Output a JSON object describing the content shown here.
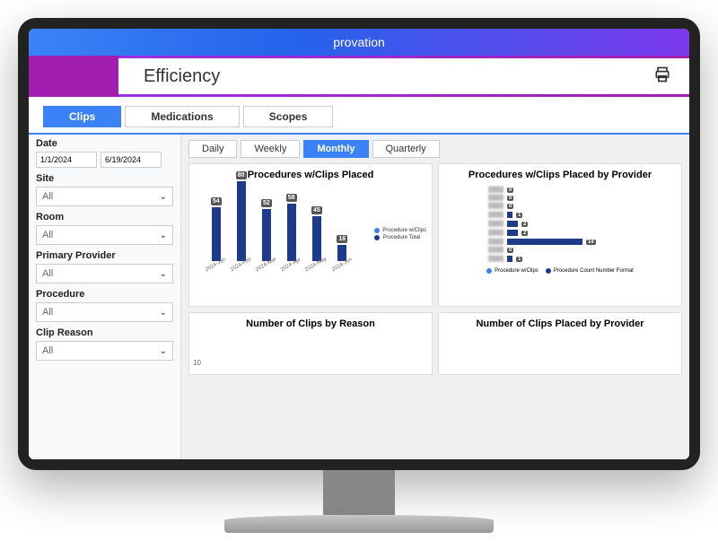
{
  "brand": "provation",
  "header": {
    "title": "Efficiency"
  },
  "main_tabs": [
    "Clips",
    "Medications",
    "Scopes"
  ],
  "active_main_tab": "Clips",
  "period_tabs": [
    "Daily",
    "Weekly",
    "Monthly",
    "Quarterly"
  ],
  "active_period": "Monthly",
  "filters": {
    "date_label": "Date",
    "date_from": "1/1/2024",
    "date_to": "6/19/2024",
    "site_label": "Site",
    "site_value": "All",
    "room_label": "Room",
    "room_value": "All",
    "provider_label": "Primary Provider",
    "provider_value": "All",
    "procedure_label": "Procedure",
    "procedure_value": "All",
    "reason_label": "Clip Reason",
    "reason_value": "All"
  },
  "charts": {
    "chart1_title": "Procedures w/Clips Placed",
    "chart2_title": "Procedures w/Clips Placed by Provider",
    "chart3_title": "Number of Clips by Reason",
    "chart4_title": "Number of Clips Placed by Provider",
    "chart3_axis": "10",
    "legend1_a": "Procedure w/Clips",
    "legend1_b": "Procedure Total",
    "legend2_a": "Procedure w/Clips",
    "legend2_b": "Procedure Count Number Format"
  },
  "chart_data": [
    {
      "type": "bar",
      "title": "Procedures w/Clips Placed",
      "categories": [
        "2024-Jan",
        "2024-Feb",
        "2024-Mar",
        "2024-Apr",
        "2024-May",
        "2024-Jun"
      ],
      "series": [
        {
          "name": "Procedure w/Clips",
          "values": [
            54,
            80,
            52,
            58,
            45,
            16
          ],
          "color": "#3b82f6"
        },
        {
          "name": "Procedure Total",
          "values": [
            54,
            80,
            52,
            58,
            45,
            16
          ],
          "color": "#1e3a8a"
        }
      ],
      "ylim": [
        0,
        90
      ]
    },
    {
      "type": "bar",
      "orientation": "horizontal",
      "title": "Procedures w/Clips Placed by Provider",
      "categories": [
        "Prov1",
        "Prov2",
        "Prov3",
        "Prov4",
        "Prov5",
        "Prov6",
        "Prov7",
        "Prov8",
        "Prov9"
      ],
      "series": [
        {
          "name": "Procedure w/Clips",
          "values": [
            0,
            0,
            0,
            1,
            2,
            2,
            14,
            0,
            1
          ],
          "color": "#3b82f6"
        },
        {
          "name": "Procedure Count Number Format",
          "values": [
            0,
            0,
            0,
            1,
            2,
            2,
            14,
            0,
            1
          ],
          "color": "#1e3a8a"
        }
      ],
      "xlim": [
        0,
        16
      ]
    },
    {
      "type": "bar",
      "title": "Number of Clips by Reason",
      "categories": [],
      "values": [],
      "ylim": [
        0,
        10
      ]
    },
    {
      "type": "bar",
      "title": "Number of Clips Placed by Provider",
      "categories": [],
      "values": []
    }
  ],
  "colors": {
    "accent": "#3b82f6",
    "bar": "#1e3a8a"
  }
}
